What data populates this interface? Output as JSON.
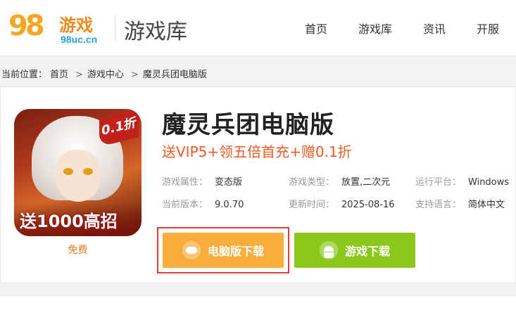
{
  "header": {
    "logo_number": "98",
    "logo_text": "游戏",
    "logo_site": "98uc.cn",
    "section_title": "游戏库",
    "nav": [
      "首页",
      "游戏库",
      "资讯",
      "开服"
    ]
  },
  "breadcrumb": {
    "prefix": "当前位置：",
    "items": [
      "首页",
      "游戏中心",
      "魔灵兵团电脑版"
    ],
    "separator": ">"
  },
  "game": {
    "icon_badge": "0.1折",
    "icon_banner": "送1000高招",
    "price": "免费",
    "title": "魔灵兵团电脑版",
    "promo": "送VIP5+领五倍首充+赠0.1折",
    "attributes": [
      {
        "key": "游戏属性：",
        "value": "变态版"
      },
      {
        "key": "游戏类型：",
        "value": "放置,二次元"
      },
      {
        "key": "运行平台：",
        "value": "Windows"
      },
      {
        "key": "当前版本：",
        "value": "9.0.70"
      },
      {
        "key": "更新时间：",
        "value": "2025-08-16"
      },
      {
        "key": "支持语言：",
        "value": "简体中文"
      }
    ]
  },
  "buttons": {
    "pc_download": "电脑版下载",
    "game_download": "游戏下载"
  },
  "colors": {
    "accent_orange": "#f9ad3c",
    "accent_green": "#8cc81c",
    "promo_red": "#f15a24",
    "highlight_border": "#e23b3b"
  }
}
